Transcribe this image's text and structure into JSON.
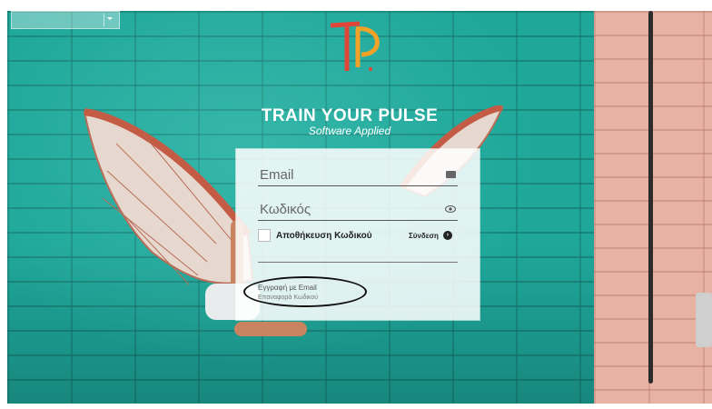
{
  "language_selector": {
    "selected": ""
  },
  "brand": {
    "title": "TRAIN YOUR PULSE",
    "subtitle": "Software Applied"
  },
  "login": {
    "email_placeholder": "Email",
    "password_placeholder": "Κωδικός",
    "remember_label": "Αποθήκευση Κωδικού",
    "login_button": "Σύνδεση",
    "register_link": "Εγγραφή με Email",
    "forgot_link": "Επαναφορά Κωδικού"
  },
  "colors": {
    "wall": "#1fa79a",
    "pink_wall": "#e8b2a3",
    "logo_red": "#e0453a",
    "logo_orange": "#f2a227"
  }
}
